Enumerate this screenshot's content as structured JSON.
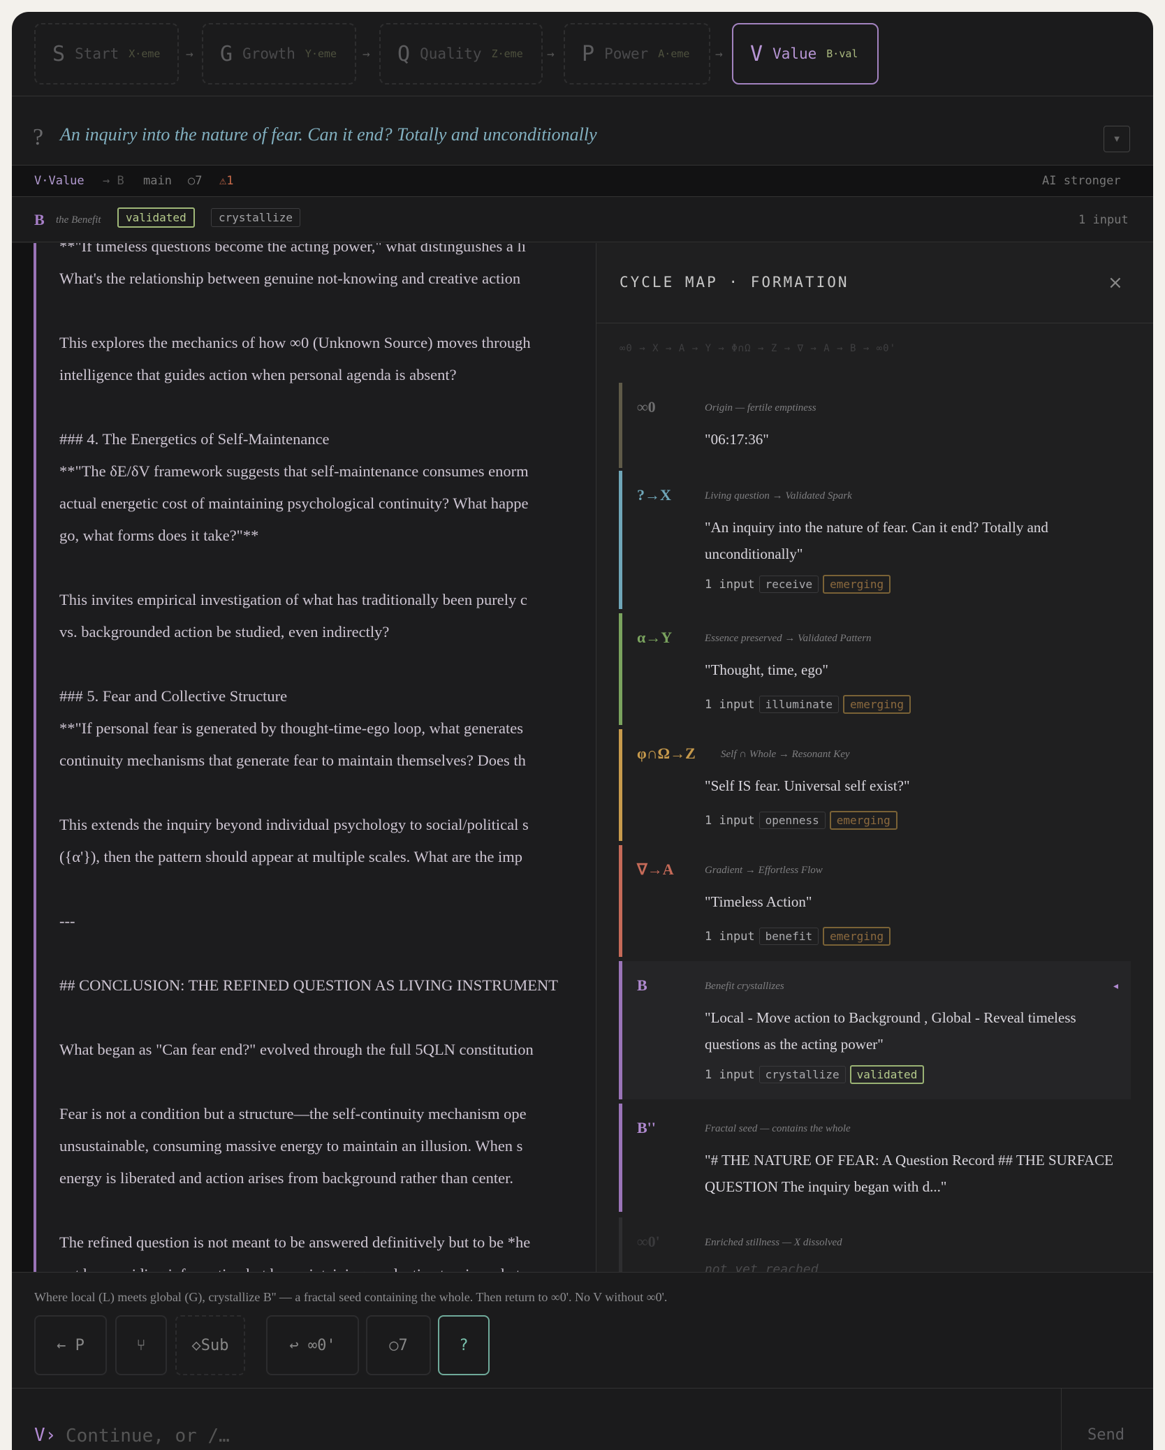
{
  "phases": [
    {
      "letter": "S",
      "name": "Start",
      "code": "X·eme"
    },
    {
      "letter": "G",
      "name": "Growth",
      "code": "Y·eme"
    },
    {
      "letter": "Q",
      "name": "Quality",
      "code": "Z·eme"
    },
    {
      "letter": "P",
      "name": "Power",
      "code": "A·eme"
    },
    {
      "letter": "V",
      "name": "Value",
      "code": "B·val"
    }
  ],
  "arrow": "→",
  "question": {
    "mark": "?",
    "text": "An inquiry into the nature of fear. Can it end? Totally and unconditionally",
    "toggle": "▼"
  },
  "status": {
    "phase": "V·Value",
    "arrow_b": "→ B",
    "branch": "main",
    "cycles": "○7",
    "warnings": "⚠1",
    "right": "AI stronger"
  },
  "brow": {
    "letter": "B",
    "subtitle": "the Benefit",
    "tag1": "validated",
    "tag2": "crystallize",
    "right": "1 input"
  },
  "prose": [
    "**\"If timeless questions become the acting power,\" what distinguishes a li",
    "What's the relationship between genuine not-knowing and creative action",
    "",
    "This explores the mechanics of how ∞0 (Unknown Source) moves through",
    "intelligence that guides action when personal agenda is absent?",
    "",
    "### 4. The Energetics of Self-Maintenance",
    "**\"The δE/δV framework suggests that self-maintenance consumes enorm",
    "actual energetic cost of maintaining psychological continuity? What happe",
    "go, what forms does it take?\"**",
    "",
    "This invites empirical investigation of what has traditionally been purely c",
    "vs. backgrounded action be studied, even indirectly?",
    "",
    "### 5. Fear and Collective Structure",
    "**\"If personal fear is generated by thought-time-ego loop, what generates",
    "continuity mechanisms that generate fear to maintain themselves? Does th",
    "",
    "This extends the inquiry beyond individual psychology to social/political s",
    "({α'}), then the pattern should appear at multiple scales. What are the imp",
    "",
    "---",
    "",
    "## CONCLUSION: THE REFINED QUESTION AS LIVING INSTRUMENT",
    "",
    "What began as \"Can fear end?\" evolved through the full 5QLN constitution",
    "",
    "Fear is not a condition but a structure—the self-continuity mechanism ope",
    "unsustainable, consuming massive energy to maintain an illusion. When s",
    "energy is liberated and action arises from background rather than center.",
    "",
    "The refined question is not meant to be answered definitively but to be *he",
    "not by providing information but by maintaining productive tension—bet"
  ],
  "panel": {
    "title": "CYCLE MAP · FORMATION",
    "close": "×",
    "path": "∞0 → X → A → Y → Φ∩Ω → Z → ∇ → A → B → ∞0'",
    "cards": [
      {
        "symbol": "∞0",
        "subtitle": "Origin — fertile emptiness",
        "text": "\"06:17:36\"",
        "input": "",
        "tag": "",
        "state": "",
        "color": "#5f5a48"
      },
      {
        "symbol": "?→X",
        "subtitle": "Living question → Validated Spark",
        "text": "\"An inquiry into the nature of fear. Can it end? Totally and unconditionally\"",
        "input": "1 input",
        "tag": "receive",
        "state": "emerging",
        "color": "#6fa6b8"
      },
      {
        "symbol": "α→Y",
        "subtitle": "Essence preserved → Validated Pattern",
        "text": "\"Thought, time, ego\"",
        "input": "1 input",
        "tag": "illuminate",
        "state": "emerging",
        "color": "#7aa35e"
      },
      {
        "symbol": "φ∩Ω→Z",
        "subtitle": "Self ∩ Whole → Resonant Key",
        "text": "\"Self IS fear. Universal self exist?\"",
        "input": "1 input",
        "tag": "openness",
        "state": "emerging",
        "color": "#c79a4c"
      },
      {
        "symbol": "∇→A",
        "subtitle": "Gradient → Effortless Flow",
        "text": "\"Timeless Action\"",
        "input": "1 input",
        "tag": "benefit",
        "state": "emerging",
        "color": "#c56a58"
      },
      {
        "symbol": "B",
        "subtitle": "Benefit crystallizes",
        "text": "\"Local - Move action to Background , Global - Reveal timeless questions as the acting power\"",
        "input": "1 input",
        "tag": "crystallize",
        "state": "validated",
        "color": "#9a74b8",
        "marker": "◂"
      },
      {
        "symbol": "B''",
        "subtitle": "Fractal seed — contains the whole",
        "text": "\"# THE NATURE OF FEAR: A Question Record ## THE SURFACE QUESTION The inquiry began with d...\"",
        "input": "",
        "tag": "",
        "state": "",
        "color": "#9a74b8"
      },
      {
        "symbol": "∞0'",
        "subtitle": "Enriched stillness — X dissolved",
        "text": "not yet reached",
        "input": "",
        "tag": "",
        "state": "",
        "color": "#2e2e30"
      }
    ]
  },
  "hint": "Where local (L) meets global (G), crystallize B'' — a fractal seed containing the whole. Then return to ∞0'. No V without ∞0'.",
  "buttons": [
    "← P",
    "⑂",
    "◇Sub",
    "↩ ∞0'",
    "○7",
    "?"
  ],
  "input": {
    "prompt": "V›",
    "placeholder": "Continue, or /…",
    "send": "Send"
  }
}
